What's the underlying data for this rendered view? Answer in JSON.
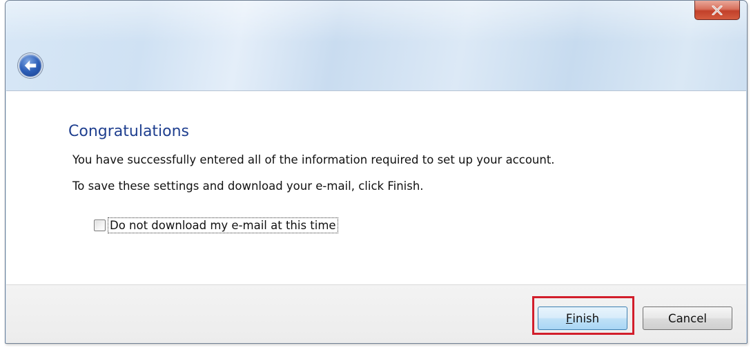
{
  "window": {
    "close_icon": "close-icon",
    "back_icon": "back-arrow-icon"
  },
  "content": {
    "title": "Congratulations",
    "line1": "You have successfully entered all of the information required to set up your account.",
    "line2": "To save these settings and download your e-mail, click Finish.",
    "checkbox_label": "Do not download my e-mail at this time",
    "checkbox_checked": false
  },
  "footer": {
    "finish_mnemonic": "F",
    "finish_rest": "inish",
    "cancel_label": "Cancel"
  },
  "colors": {
    "title": "#1f3f8f",
    "highlight": "#d21e2b",
    "close_button": "#c2412a"
  }
}
